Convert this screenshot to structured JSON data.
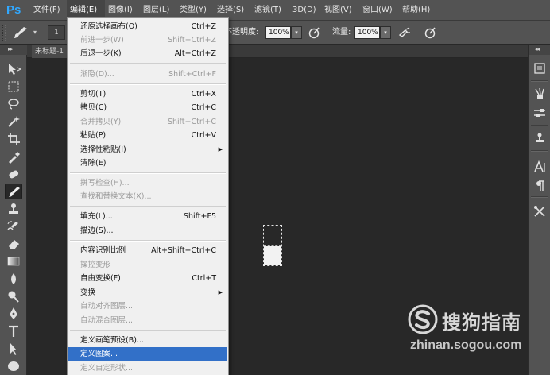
{
  "app": {
    "logo_text": "Ps"
  },
  "menubar": {
    "items": [
      {
        "label": "文件(F)"
      },
      {
        "label": "编辑(E)"
      },
      {
        "label": "图像(I)"
      },
      {
        "label": "图层(L)"
      },
      {
        "label": "类型(Y)"
      },
      {
        "label": "选择(S)"
      },
      {
        "label": "滤镜(T)"
      },
      {
        "label": "3D(D)"
      },
      {
        "label": "视图(V)"
      },
      {
        "label": "窗口(W)"
      },
      {
        "label": "帮助(H)"
      }
    ]
  },
  "options": {
    "brush_size": "1",
    "opacity_label": "不透明度:",
    "opacity_value": "100%",
    "flow_label": "流量:",
    "flow_value": "100%"
  },
  "document": {
    "tab_title": "未标题-1"
  },
  "edit_menu": {
    "items": [
      {
        "label": "还原选择画布(O)",
        "shortcut": "Ctrl+Z",
        "state": "normal"
      },
      {
        "label": "前进一步(W)",
        "shortcut": "Shift+Ctrl+Z",
        "state": "disabled"
      },
      {
        "label": "后退一步(K)",
        "shortcut": "Alt+Ctrl+Z",
        "state": "normal"
      },
      {
        "label": "渐隐(D)...",
        "shortcut": "Shift+Ctrl+F",
        "state": "disabled"
      },
      {
        "label": "剪切(T)",
        "shortcut": "Ctrl+X",
        "state": "normal"
      },
      {
        "label": "拷贝(C)",
        "shortcut": "Ctrl+C",
        "state": "normal"
      },
      {
        "label": "合并拷贝(Y)",
        "shortcut": "Shift+Ctrl+C",
        "state": "disabled"
      },
      {
        "label": "粘贴(P)",
        "shortcut": "Ctrl+V",
        "state": "normal"
      },
      {
        "label": "选择性粘贴(I)",
        "shortcut": "",
        "state": "normal",
        "submenu": true
      },
      {
        "label": "清除(E)",
        "shortcut": "",
        "state": "normal"
      },
      {
        "label": "拼写检查(H)...",
        "shortcut": "",
        "state": "disabled"
      },
      {
        "label": "查找和替换文本(X)...",
        "shortcut": "",
        "state": "disabled"
      },
      {
        "label": "填充(L)...",
        "shortcut": "Shift+F5",
        "state": "normal"
      },
      {
        "label": "描边(S)...",
        "shortcut": "",
        "state": "normal"
      },
      {
        "label": "内容识别比例",
        "shortcut": "Alt+Shift+Ctrl+C",
        "state": "normal"
      },
      {
        "label": "操控变形",
        "shortcut": "",
        "state": "disabled"
      },
      {
        "label": "自由变换(F)",
        "shortcut": "Ctrl+T",
        "state": "normal"
      },
      {
        "label": "变换",
        "shortcut": "",
        "state": "normal",
        "submenu": true
      },
      {
        "label": "自动对齐图层...",
        "shortcut": "",
        "state": "disabled"
      },
      {
        "label": "自动混合图层...",
        "shortcut": "",
        "state": "disabled"
      },
      {
        "label": "定义画笔预设(B)...",
        "shortcut": "",
        "state": "normal"
      },
      {
        "label": "定义图案...",
        "shortcut": "",
        "state": "highlighted"
      },
      {
        "label": "定义自定形状...",
        "shortcut": "",
        "state": "disabled"
      }
    ]
  },
  "watermark": {
    "title": "搜狗指南",
    "url": "zhinan.sogou.com"
  },
  "colors": {
    "accent": "#31a8ff",
    "highlight": "#3270c8",
    "ui_bg": "#535353",
    "canvas": "#282828"
  }
}
